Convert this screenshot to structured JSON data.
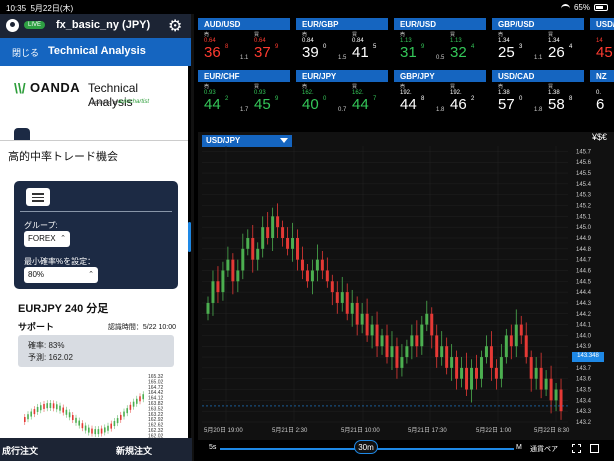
{
  "status_bar": {
    "time": "10:35",
    "date": "5月22日(木)",
    "battery": "65%"
  },
  "account": {
    "badge": "LIVE",
    "name": "fx_basic_ny (JPY)"
  },
  "ta_header": {
    "close": "閉じる",
    "title": "Technical Analysis"
  },
  "logo": {
    "brand": "OANDA",
    "brand_sub": "Technical Analysis",
    "powered": "powered by",
    "partner": "autochartist"
  },
  "panel": {
    "section_title": "高的中率トレード機会",
    "group_label": "グループ:",
    "group_value": "FOREX",
    "min_prob_label": "最小確率%を設定：",
    "min_prob_value": "80%",
    "pair_title": "EURJPY 240 分足",
    "support_label": "サポート",
    "recog_time": "認識時間：5/22 10:00",
    "prob_row": "確率: 83%",
    "forecast_row": "予測: 162.02",
    "mini_ticks": [
      "165.32",
      "165.02",
      "164.72",
      "164.42",
      "164.12",
      "163.82",
      "163.52",
      "163.22",
      "162.92",
      "162.62",
      "162.32",
      "162.02"
    ]
  },
  "bottom_bar": {
    "market_order": "成行注文",
    "new_order": "新規注文"
  },
  "tiles": [
    {
      "pair": "AUD/USD",
      "sell": "売",
      "buy": "買",
      "s_small": "0.64",
      "s_big": "36",
      "s_sup": "8",
      "b_small": "0.64",
      "b_big": "37",
      "b_sup": "9",
      "spread": "1.1",
      "color": "#ff3b30"
    },
    {
      "pair": "EUR/GBP",
      "sell": "売",
      "buy": "買",
      "s_small": "0.84",
      "s_big": "39",
      "s_sup": "0",
      "b_small": "0.84",
      "b_big": "41",
      "b_sup": "5",
      "spread": "1.5",
      "color": "#ffffff"
    },
    {
      "pair": "EUR/USD",
      "sell": "売",
      "buy": "買",
      "s_small": "1.13",
      "s_big": "31",
      "s_sup": "9",
      "b_small": "1.13",
      "b_big": "32",
      "b_sup": "4",
      "spread": "0.5",
      "color": "#34c759"
    },
    {
      "pair": "GBP/USD",
      "sell": "売",
      "buy": "買",
      "s_small": "1.34",
      "s_big": "25",
      "s_sup": "3",
      "b_small": "1.34",
      "b_big": "26",
      "b_sup": "4",
      "spread": "1.1",
      "color": "#ffffff"
    },
    {
      "pair": "EUR/CHF",
      "sell": "売",
      "buy": "買",
      "s_small": "0.93",
      "s_big": "44",
      "s_sup": "2",
      "b_small": "0.93",
      "b_big": "45",
      "b_sup": "9",
      "spread": "1.7",
      "color": "#34c759"
    },
    {
      "pair": "EUR/JPY",
      "sell": "売",
      "buy": "買",
      "s_small": "162.",
      "s_big": "40",
      "s_sup": "0",
      "b_small": "162.",
      "b_big": "44",
      "b_sup": "7",
      "spread": "0.7",
      "color": "#34c759"
    },
    {
      "pair": "GBP/JPY",
      "sell": "売",
      "buy": "買",
      "s_small": "192.",
      "s_big": "44",
      "s_sup": "8",
      "b_small": "192.",
      "b_big": "46",
      "b_sup": "2",
      "spread": "1.8",
      "color": "#ffffff"
    },
    {
      "pair": "USD/CAD",
      "sell": "売",
      "buy": "買",
      "s_small": "1.38",
      "s_big": "57",
      "s_sup": "0",
      "b_small": "1.38",
      "b_big": "58",
      "b_sup": "8",
      "spread": "1.8",
      "color": "#ffffff"
    }
  ],
  "tiles_partial": [
    {
      "pair": "USD/",
      "s_small": "14",
      "s_big": "45",
      "color": "#ff3b30"
    },
    {
      "pair": "NZ",
      "s_small": "0.",
      "s_big": "6",
      "color": "#ffffff"
    }
  ],
  "chart": {
    "pair": "USD/JPY",
    "price_label": "143.348",
    "ccy_icon": "¥$€",
    "zoom_left": "5s",
    "zoom_value": "30m",
    "zoom_right": "M",
    "pair_button": "通貨ペア"
  },
  "chart_data": {
    "type": "candlestick",
    "y_ticks": [
      "145.7",
      "145.6",
      "145.5",
      "145.4",
      "145.3",
      "145.2",
      "145.1",
      "145.0",
      "144.9",
      "144.8",
      "144.7",
      "144.6",
      "144.5",
      "144.4",
      "144.3",
      "144.2",
      "144.1",
      "144.0",
      "143.9",
      "143.8",
      "143.7",
      "143.6",
      "143.5",
      "143.4",
      "143.3",
      "143.2"
    ],
    "x_ticks": [
      "5月20日 19:00",
      "5月21日 2:30",
      "5月21日 10:00",
      "5月21日 17:30",
      "5月22日 1:00",
      "5月22日 8:30"
    ],
    "ylim": [
      143.2,
      145.75
    ],
    "current": 143.348,
    "closes": [
      144.3,
      144.5,
      144.4,
      144.6,
      144.7,
      144.5,
      144.6,
      144.8,
      144.9,
      144.7,
      144.8,
      145.0,
      144.9,
      145.1,
      145.0,
      144.9,
      144.8,
      144.9,
      144.7,
      144.6,
      144.5,
      144.6,
      144.7,
      144.6,
      144.5,
      144.4,
      144.3,
      144.4,
      144.2,
      144.3,
      144.1,
      144.2,
      144.0,
      144.1,
      143.9,
      144.0,
      143.8,
      143.9,
      143.7,
      143.8,
      143.9,
      144.0,
      143.9,
      144.1,
      144.2,
      144.0,
      143.8,
      143.9,
      143.7,
      143.8,
      143.6,
      143.7,
      143.5,
      143.7,
      143.6,
      143.8,
      143.9,
      143.7,
      143.6,
      143.8,
      144.0,
      143.9,
      144.1,
      144.0,
      143.8,
      143.6,
      143.7,
      143.5,
      143.6,
      143.4,
      143.5,
      143.3
    ]
  }
}
